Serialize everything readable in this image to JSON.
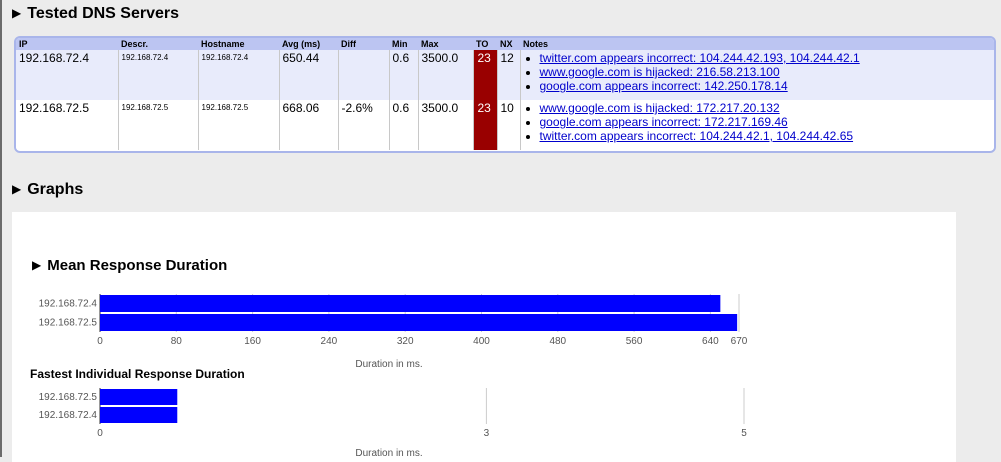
{
  "sections": {
    "dns_title": "Tested DNS Servers",
    "graphs_title": "Graphs"
  },
  "table": {
    "headers": [
      "IP",
      "Descr.",
      "Hostname",
      "Avg (ms)",
      "Diff",
      "Min",
      "Max",
      "TO",
      "NX",
      "Notes"
    ],
    "rows": [
      {
        "ip": "192.168.72.4",
        "descr": "192.168.72.4",
        "hostname": "192.168.72.4",
        "avg": "650.44",
        "diff": "",
        "min": "0.6",
        "max": "3500.0",
        "to": "23",
        "nx": "12",
        "notes": [
          "twitter.com appears incorrect: 104.244.42.193, 104.244.42.1",
          "www.google.com is hijacked: 216.58.213.100",
          "google.com appears incorrect: 142.250.178.14"
        ]
      },
      {
        "ip": "192.168.72.5",
        "descr": "192.168.72.5",
        "hostname": "192.168.72.5",
        "avg": "668.06",
        "diff": "-2.6%",
        "min": "0.6",
        "max": "3500.0",
        "to": "23",
        "nx": "10",
        "notes": [
          "www.google.com is hijacked: 172.217.20.132",
          "google.com appears incorrect: 172.217.169.46",
          "twitter.com appears incorrect: 104.244.42.1, 104.244.42.65"
        ]
      }
    ]
  },
  "colors": {
    "bar": "#0000ff",
    "timeout_bg": "#990000",
    "header_bg": "#bcc5f2"
  },
  "chart_data": [
    {
      "type": "bar",
      "orientation": "horizontal",
      "title": "Mean Response Duration",
      "categories": [
        "192.168.72.4",
        "192.168.72.5"
      ],
      "values": [
        650.44,
        668.06
      ],
      "xlabel": "Duration in ms.",
      "xlim": [
        0,
        670
      ],
      "ticks": [
        0,
        80,
        160,
        240,
        320,
        400,
        480,
        560,
        640,
        670
      ]
    },
    {
      "type": "bar",
      "orientation": "horizontal",
      "title": "Fastest Individual Response Duration",
      "categories": [
        "192.168.72.5",
        "192.168.72.4"
      ],
      "values": [
        0.6,
        0.6
      ],
      "xlabel": "Duration in ms.",
      "xlim": [
        0,
        5
      ],
      "ticks": [
        0,
        3,
        5
      ]
    }
  ]
}
